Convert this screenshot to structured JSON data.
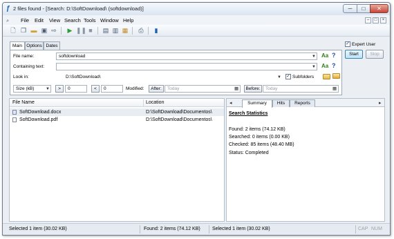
{
  "window": {
    "title": "2 files found - [Search: D:\\SoftDownload\\ (softdownload)]",
    "controls": {
      "minimize": "─",
      "maximize": "□",
      "close": "✕"
    }
  },
  "menubar": {
    "items": [
      "File",
      "Edit",
      "View",
      "Search",
      "Tools",
      "Window",
      "Help"
    ],
    "mdi_controls": [
      "–",
      "□",
      "×"
    ]
  },
  "toolbar": {
    "icons": [
      "new-icon",
      "copy-icon",
      "open-folder-icon",
      "save-icon",
      "export-icon",
      "play-icon",
      "pause-icon",
      "stop-icon",
      "window-icon",
      "window-split-icon",
      "report-icon",
      "print-icon",
      "book-icon"
    ]
  },
  "search": {
    "tabs": [
      "Main",
      "Options",
      "Dates"
    ],
    "file_name_label": "File name:",
    "file_name_value": "softdownload",
    "containing_text_label": "Containing text:",
    "containing_text_value": "",
    "look_in_label": "Look in:",
    "look_in_value": "D:\\SoftDownload\\",
    "subfolders_label": "Subfolders",
    "subfolders_checked": true,
    "size_select": "Size (kB)",
    "gt_label": ">",
    "gt_value": "0",
    "lt_label": "<",
    "lt_value": "0",
    "modified_label": "Modified:",
    "after_button": "After:",
    "after_value": "Today",
    "before_button": "Before:",
    "before_value": "Today",
    "case_label": "Aa",
    "help_label": "?"
  },
  "side": {
    "expert_user_label": "Expert User",
    "expert_user_checked": true,
    "start_label": "Start",
    "stop_label": "Stop"
  },
  "results": {
    "columns": [
      "File Name",
      "Location"
    ],
    "rows": [
      {
        "name": "SoftDownload.docx",
        "location": "D:\\SoftDownload\\Documentos\\",
        "type": "docx",
        "selected": true
      },
      {
        "name": "SoftDownload.pdf",
        "location": "D:\\SoftDownload\\Documentos\\",
        "type": "pdf",
        "selected": false
      }
    ]
  },
  "right_pane": {
    "tabs": [
      "Summary",
      "Hits",
      "Reports"
    ],
    "nav_prev": "◂",
    "nav_next": "▸",
    "stats_title": "Search Statistics",
    "stats": [
      "Found: 2 items (74.12 KB)",
      "Searched: 0 items (0.00 KB)",
      "Checked: 85 items (48.40 MB)",
      "Status: Completed"
    ]
  },
  "statusbar": {
    "left": "Selected 1 item (30.02 KB)",
    "middle": "Found: 2 items (74.12 KB)",
    "right": "Selected 1 item (30.02 KB)",
    "caps": "CAP",
    "num": "NUM"
  },
  "colors": {
    "title_gradient_top": "#f4f8fc",
    "close_button": "#c8463a",
    "case_icon": "#2f7d1a",
    "help_icon": "#1c4fa8",
    "start_button": "#bde3f9"
  }
}
